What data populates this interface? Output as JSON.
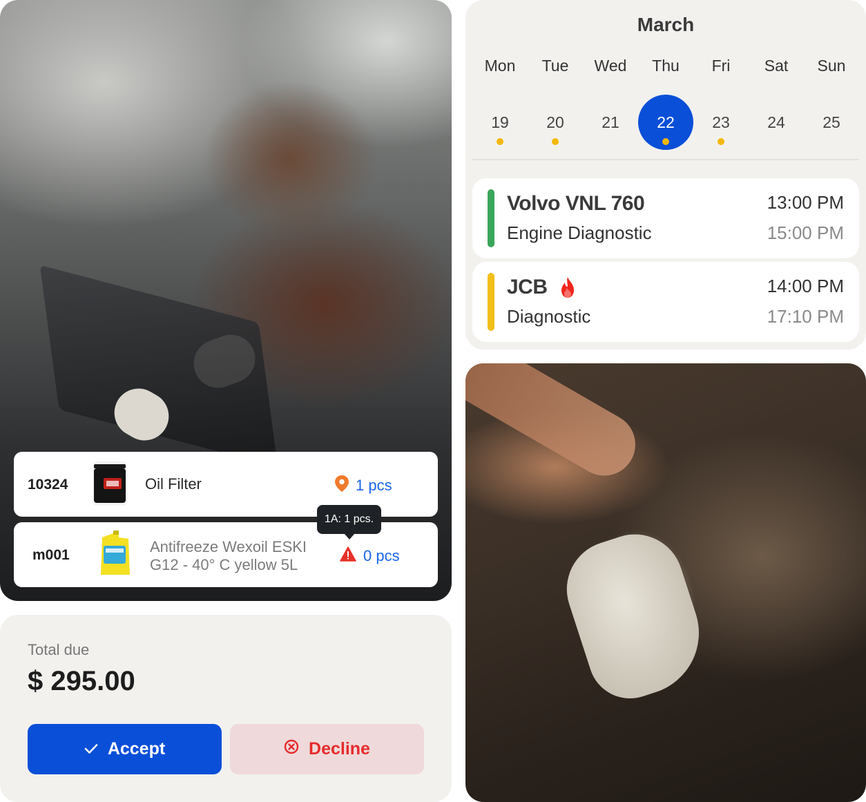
{
  "calendar": {
    "month": "March",
    "days": [
      {
        "name": "Mon",
        "num": "19",
        "dot": true,
        "selected": false
      },
      {
        "name": "Tue",
        "num": "20",
        "dot": true,
        "selected": false
      },
      {
        "name": "Wed",
        "num": "21",
        "dot": false,
        "selected": false
      },
      {
        "name": "Thu",
        "num": "22",
        "dot": true,
        "selected": true
      },
      {
        "name": "Fri",
        "num": "23",
        "dot": true,
        "selected": false
      },
      {
        "name": "Sat",
        "num": "24",
        "dot": false,
        "selected": false
      },
      {
        "name": "Sun",
        "num": "25",
        "dot": false,
        "selected": false
      }
    ],
    "appointments": [
      {
        "title": "Volvo VNL 760",
        "subtitle": "Engine Diagnostic",
        "start": "13:00 PM",
        "end": "15:00 PM",
        "color": "#3aa65b",
        "urgent": false
      },
      {
        "title": "JCB",
        "subtitle": "Diagnostic",
        "start": "14:00 PM",
        "end": "17:10 PM",
        "color": "#f2be1a",
        "urgent": true
      }
    ]
  },
  "parts": [
    {
      "code": "10324",
      "name": "Oil Filter",
      "qty": "1 pcs",
      "status_icon": "location-pin-icon"
    },
    {
      "code": "m001",
      "name_line1": "Antifreeze Wexoil ESKI",
      "name_line2": "G12 - 40° C yellow 5L",
      "qty": "0 pcs",
      "status_icon": "warning-icon"
    }
  ],
  "tooltip": {
    "text": "1A: 1 pcs."
  },
  "total": {
    "label": "Total due",
    "amount": "$ 295.00",
    "accept_label": "Accept",
    "decline_label": "Decline"
  },
  "colors": {
    "primary": "#0a4fd8",
    "accent_yellow": "#f3b80c",
    "danger": "#e52b2b",
    "link_blue": "#1a66e6"
  }
}
